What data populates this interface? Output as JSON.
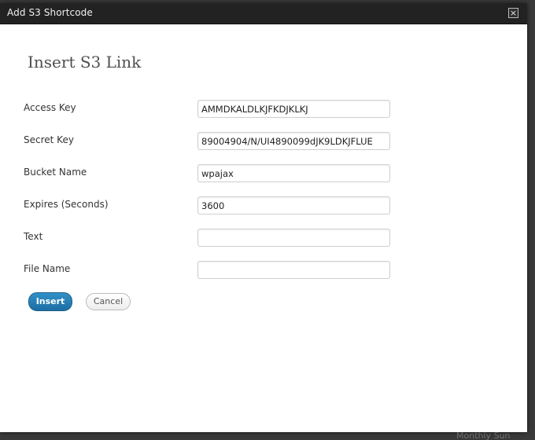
{
  "dialog": {
    "title": "Add S3 Shortcode",
    "close_symbol": "×",
    "close_icon": "close-icon"
  },
  "form": {
    "heading": "Insert S3 Link",
    "fields": [
      {
        "label": "Access Key",
        "value": "AMMDKALDLKJFKDJKLKJ",
        "placeholder": ""
      },
      {
        "label": "Secret Key",
        "value": "89004904/N/UI4890099dJK9LDKJFLUE",
        "placeholder": ""
      },
      {
        "label": "Bucket Name",
        "value": "wpajax",
        "placeholder": ""
      },
      {
        "label": "Expires (Seconds)",
        "value": "3600",
        "placeholder": ""
      },
      {
        "label": "Text",
        "value": "",
        "placeholder": ""
      },
      {
        "label": "File Name",
        "value": "",
        "placeholder": ""
      }
    ],
    "buttons": {
      "insert_label": "Insert",
      "cancel_label": "Cancel"
    }
  },
  "backdrop": {
    "partial_text_1": "Monthly Sun"
  },
  "colors": {
    "primary_button": "#2180b9",
    "titlebar": "#222222"
  }
}
